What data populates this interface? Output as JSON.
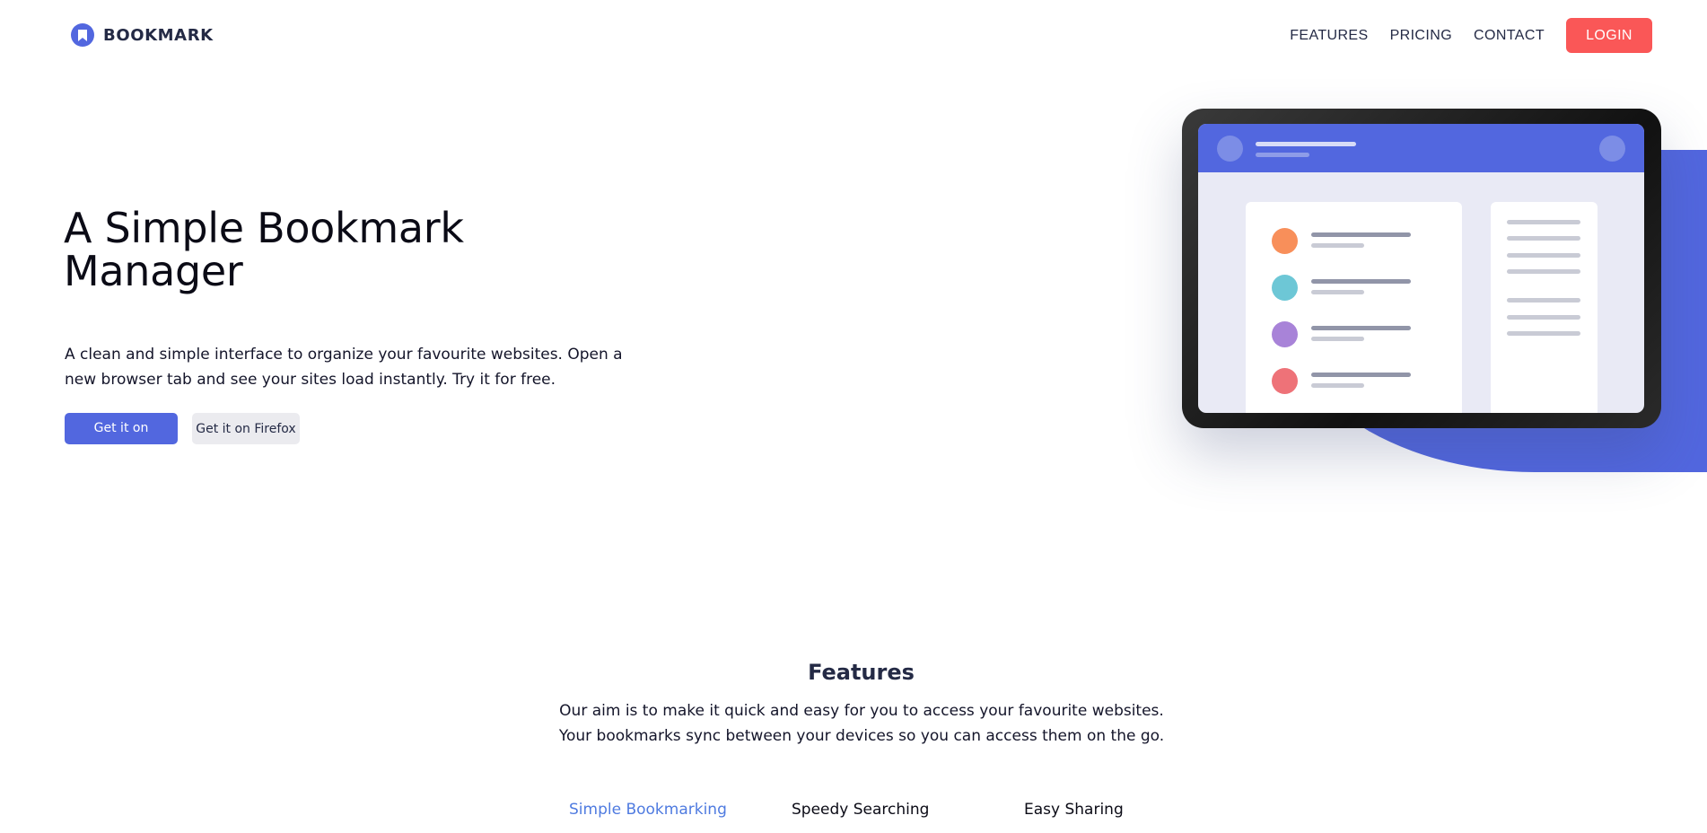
{
  "brand": {
    "name": "BOOKMARK",
    "logo_icon": "bookmark-icon",
    "accent": "#5267df"
  },
  "nav": {
    "links": [
      "FEATURES",
      "PRICING",
      "CONTACT"
    ],
    "login_label": "LOGIN",
    "login_color": "#fa5757"
  },
  "hero": {
    "title": "A Simple Bookmark Manager",
    "description": "A clean and simple interface to organize your favourite websites. Open a new browser tab and see your sites load instantly. Try it for free.",
    "chrome_button": "Get it on Chrome",
    "firefox_button": "Get it on Firefox"
  },
  "illustration": {
    "list_colors": [
      "#f88f5a",
      "#6dc7d6",
      "#a883d8",
      "#ee7278"
    ]
  },
  "features": {
    "title": "Features",
    "description": "Our aim is to make it quick and easy for you to access your favourite websites. Your bookmarks sync between your devices so you can access them on the go.",
    "tabs": [
      "Simple Bookmarking",
      "Speedy Searching",
      "Easy Sharing"
    ],
    "active_tab": "Simple Bookmarking"
  }
}
